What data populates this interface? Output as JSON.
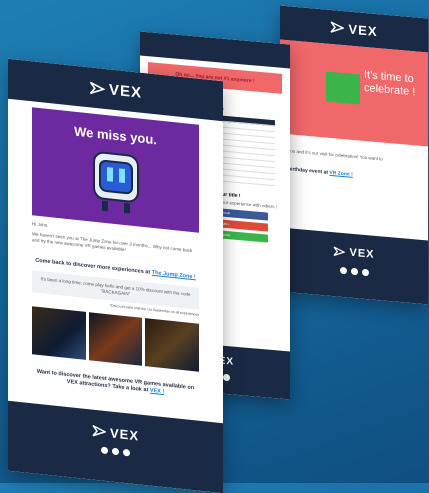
{
  "brand": "VEX",
  "back_email": {
    "hero_text": "It's time to celebrate !",
    "body_fragment": "you and it's our visit for celebration! You want to",
    "cta_fragment": "birthday event at",
    "cta_link": "VR Zone !"
  },
  "middle_email": {
    "alert_title": "Oh no... You are not #1 anymore !",
    "leaderboard_title": "TOP 10",
    "leaderboard_rows": 10,
    "claim_title": "claim back your title !",
    "share_title": "on any of the social media below your experience with others !",
    "share_buttons": [
      "Share on Facebook",
      "Share on Google+",
      "Share on Instagram"
    ]
  },
  "front_email": {
    "hero_title": "We miss you.",
    "greeting": "Hi John,",
    "intro": "We haven't seen you at The Jump Zone for over 3 months... Why not come back and try the new awesome VR games available!",
    "section_title_1": "Come back to discover more experiences at",
    "section_link_1": "The Jump Zone !",
    "promo_text": "It's been a long time; come play hello and get a 10% discount with the code \"BACKAGAIN\"",
    "promo_note": "*Discount valid until the 1st September on all experiences",
    "section_title_2": "Want to discover the latest awesome VR games available on VEX attractions? Take a look at",
    "section_link_2": "VEX !"
  },
  "colors": {
    "navy": "#1b2a44",
    "purple": "#6d2aa0",
    "coral": "#f0686a",
    "background": "#1669a0"
  }
}
